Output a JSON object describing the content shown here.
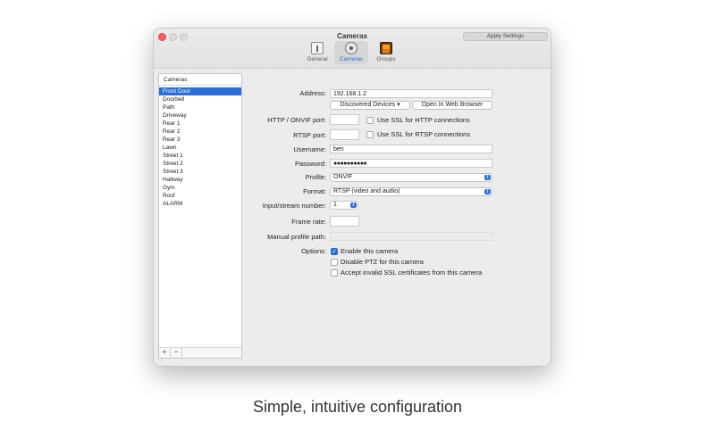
{
  "window": {
    "title": "Cameras",
    "apply_button": "Apply Settings"
  },
  "tabs": [
    {
      "label": "General",
      "icon": "general-icon"
    },
    {
      "label": "Cameras",
      "icon": "camera-icon"
    },
    {
      "label": "Groups",
      "icon": "groups-icon"
    }
  ],
  "camera_list": {
    "header": "Cameras",
    "items": [
      "Front Door",
      "Doorbell",
      "Path",
      "Driveway",
      "Rear 1",
      "Rear 2",
      "Rear 3",
      "Lawn",
      "Street 1",
      "Street 2",
      "Street 3",
      "Hallway",
      "Gym",
      "Roof",
      "ALARM"
    ],
    "selected": "Front Door",
    "add_label": "+",
    "remove_label": "−"
  },
  "form": {
    "address_label": "Address:",
    "address_value": "192.168.1.2",
    "discovered_button": "Discovered Devices ▾",
    "open_browser_button": "Open In Web Browser",
    "http_port_label": "HTTP / ONVIF port:",
    "http_port_value": "",
    "ssl_http_label": "Use SSL for HTTP connections",
    "rtsp_port_label": "RTSP port:",
    "rtsp_port_value": "",
    "ssl_rtsp_label": "Use SSL for RTSP connections",
    "username_label": "Username:",
    "username_value": "ben",
    "password_label": "Password:",
    "password_value": "●●●●●●●●●●",
    "profile_label": "Profile:",
    "profile_value": "ONVIF",
    "format_label": "Format:",
    "format_value": "RTSP (video and audio)",
    "stream_label": "Input/stream number:",
    "stream_value": "1",
    "frame_rate_label": "Frame rate:",
    "frame_rate_value": "",
    "manual_profile_label": "Manual profile path:",
    "manual_profile_value": "",
    "options_label": "Options:",
    "opt_enable": "Enable this camera",
    "opt_disable_ptz": "Disable PTZ for this camera",
    "opt_accept_ssl": "Accept invalid SSL certificates from this camera"
  },
  "caption": "Simple, intuitive configuration",
  "colors": {
    "accent": "#2a6fd6",
    "close": "#fd5f57"
  }
}
